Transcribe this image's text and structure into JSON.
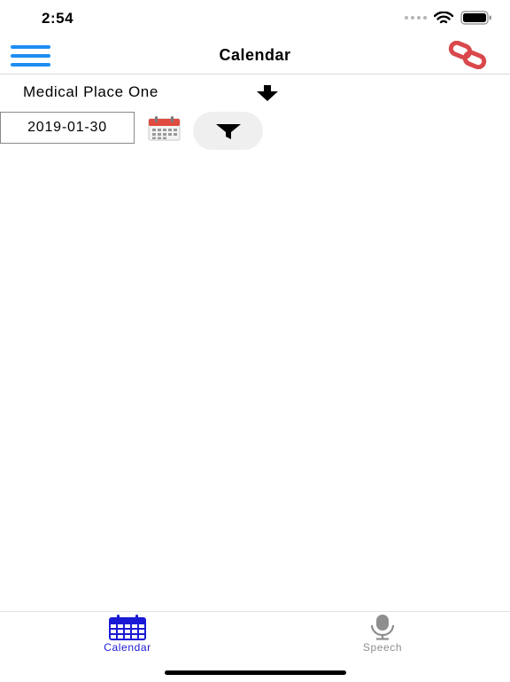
{
  "status_bar": {
    "time": "2:54"
  },
  "nav": {
    "title": "Calendar"
  },
  "place": {
    "name": "Medical Place One"
  },
  "date_filter": {
    "date": "2019-01-30"
  },
  "tabs": [
    {
      "label": "Calendar",
      "icon": "calendar-icon",
      "active": true
    },
    {
      "label": "Speech",
      "icon": "microphone-icon",
      "active": false
    }
  ],
  "colors": {
    "accent": "#1e8df2",
    "tab_active": "#1a1ad6",
    "tab_inactive": "#8e8e8e",
    "link_icon": "#d9484b",
    "calendar_header": "#e04b3f"
  }
}
